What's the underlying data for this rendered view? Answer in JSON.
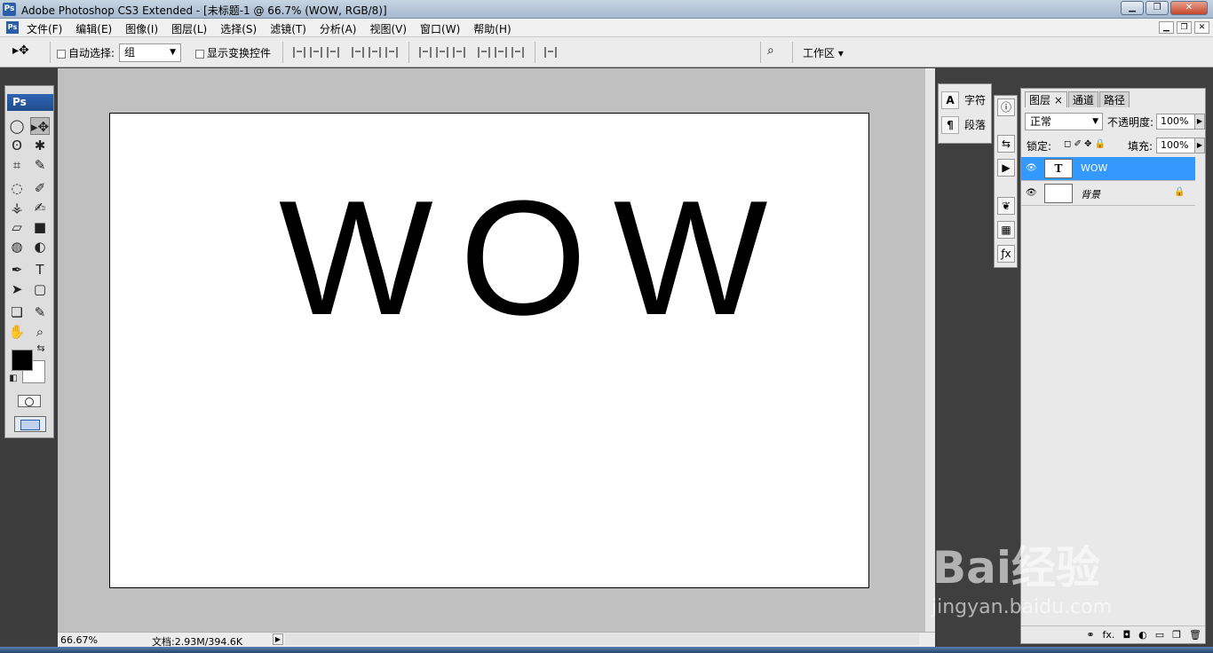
{
  "window": {
    "app_icon": "Ps",
    "title": "Adobe Photoshop CS3 Extended - [未标题-1 @ 66.7% (WOW, RGB/8)]",
    "minimize": "▁",
    "maximize": "❐",
    "close": "✕"
  },
  "menubar": {
    "app_icon": "Ps",
    "items": [
      "文件(F)",
      "编辑(E)",
      "图像(I)",
      "图层(L)",
      "选择(S)",
      "滤镜(T)",
      "分析(A)",
      "视图(V)",
      "窗口(W)",
      "帮助(H)"
    ],
    "doc_controls": [
      "▁",
      "❐",
      "✕"
    ]
  },
  "options": {
    "tool_glyph": "▸✥",
    "auto_select": "自动选择:",
    "auto_select_value": "组",
    "show_transform": "显示变换控件",
    "bridge_glyph": "⌕",
    "workspace": "工作区 ▾"
  },
  "toolbox": {
    "logo": "Ps",
    "tools": [
      "◯",
      "▸✥",
      "ʘ",
      "✱",
      "⌗",
      "✎",
      "◌",
      "✐",
      "⚶",
      "✍",
      "▱",
      "■",
      "◍",
      "◐",
      "✒",
      "T",
      "➤",
      "▢",
      "❏",
      "✎",
      "✋",
      "⌕"
    ],
    "swap_glyph": "⇆",
    "default_glyph": "◧"
  },
  "canvas": {
    "text": "WOW",
    "zoom": "66.67%"
  },
  "status": {
    "zoom": "66.67%",
    "doc": "文档:2.93M/394.6K",
    "nav": "▶"
  },
  "docks": {
    "char_label": "字符",
    "para_label": "段落",
    "char_icon": "A",
    "para_icon": "¶",
    "side_icons": [
      "ⓘ",
      "⇆",
      "▶",
      "❦",
      "▦",
      "ƒx"
    ]
  },
  "layers": {
    "tabs": [
      "图层 ×",
      "通道",
      "路径"
    ],
    "blend": "正常",
    "opacity_label": "不透明度:",
    "opacity": "100%",
    "lock_label": "锁定:",
    "fill_label": "填充:",
    "fill": "100%",
    "rows": [
      {
        "name": "WOW",
        "thumb": "T",
        "eye": "👁"
      },
      {
        "name": "背景",
        "thumb": "",
        "eye": "👁",
        "lock": "🔒"
      }
    ],
    "footer": [
      "⚭",
      "fx.",
      "◘",
      "◐",
      "▭",
      "❐",
      "🗑"
    ]
  },
  "watermark": {
    "brand": "Bai经验",
    "url": "jingyan.baidu.com"
  }
}
